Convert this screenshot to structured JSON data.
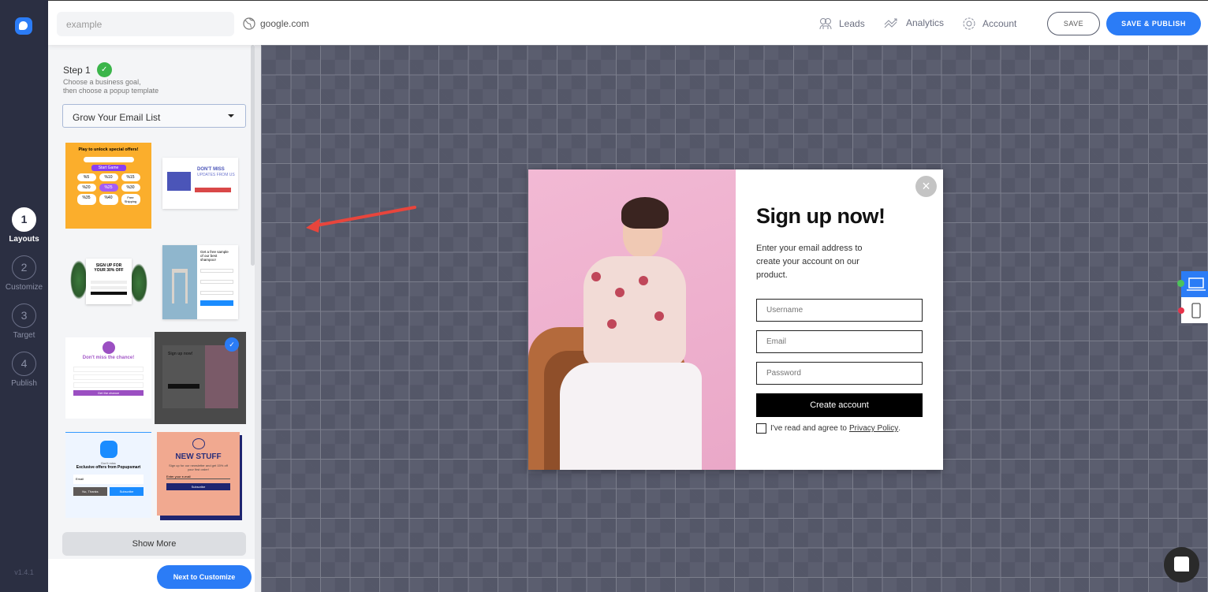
{
  "sidebar": {
    "version": "v1.4.1",
    "steps": [
      {
        "num": "1",
        "label": "Layouts"
      },
      {
        "num": "2",
        "label": "Customize"
      },
      {
        "num": "3",
        "label": "Target"
      },
      {
        "num": "4",
        "label": "Publish"
      }
    ]
  },
  "header": {
    "name_value": "example",
    "domain": "google.com",
    "nav": [
      {
        "label": "Leads",
        "icon": "leads-icon"
      },
      {
        "label": "Analytics",
        "icon": "analytics-icon"
      },
      {
        "label": "Account",
        "icon": "gear-icon"
      }
    ],
    "save": "SAVE",
    "save_publish": "SAVE & PUBLISH"
  },
  "panel": {
    "step_title": "Step 1",
    "desc_line1": "Choose a business goal,",
    "desc_line2": "then choose a popup template",
    "goal": "Grow Your Email List",
    "show_more": "Show More",
    "next": "Next to Customize",
    "templates": [
      {
        "title": "Play to unlock special offers!",
        "button": "Start Game",
        "offers": [
          "%5",
          "%10",
          "%15",
          "%20",
          "%25",
          "%30",
          "%35",
          "%40",
          "Free Shipping"
        ]
      },
      {
        "title": "DON'T MISS",
        "subtitle": "UPDATES FROM US"
      },
      {
        "title": "SIGN UP FOR YOUR 30% OFF"
      },
      {
        "title": "Get a free sample of our best shampoo!"
      },
      {
        "title": "Don't miss the chance!",
        "button": "Get the chance"
      },
      {
        "title": "Sign up now!",
        "selected": true
      },
      {
        "pre": "Don't miss",
        "title": "Exclusive offers from Popupsmart",
        "input": "Email",
        "no": "No, Thanks",
        "yes": "Subscribe"
      },
      {
        "title": "NEW STUFF",
        "text": "Sign up for our newsletter and get 15% off your first order!",
        "input": "Enter your e-mail",
        "button": "Subscribe"
      }
    ]
  },
  "popup": {
    "title": "Sign up now!",
    "description": "Enter your email address to create your account on our product.",
    "username_placeholder": "Username",
    "email_placeholder": "Email",
    "password_placeholder": "Password",
    "button": "Create account",
    "agree_text": "I've read and agree to",
    "privacy_link": "Privacy Policy",
    "close": "×"
  },
  "devices": {
    "active": "desktop"
  },
  "colors": {
    "accent": "#2b7cf6",
    "rail": "#2b2f42",
    "success": "#3bb54a",
    "arrow": "#e8453c"
  }
}
